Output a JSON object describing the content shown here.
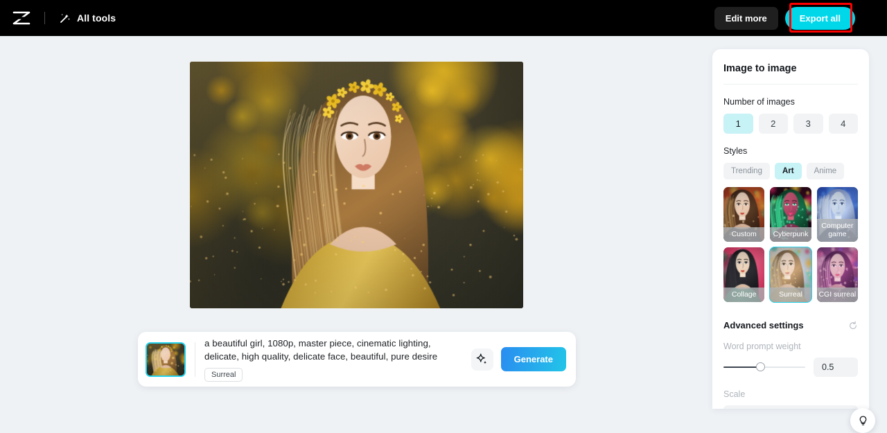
{
  "topbar": {
    "logo_icon": "capcut-logo-icon",
    "all_tools_icon": "magic-wand-icon",
    "all_tools_label": "All tools",
    "edit_more_label": "Edit more",
    "export_all_label": "Export all",
    "export_all_bg": "#00d8ea",
    "highlight_color": "#ff0000",
    "bar_bg": "#000000"
  },
  "canvas": {
    "background": "#eff2f5",
    "hero_alt": "generated-portrait-girl-with-yellow-flower-crown"
  },
  "prompt_bar": {
    "thumbnail_name": "source-image-thumbnail",
    "thumbnail_border": "#22d3ee",
    "text": "a beautiful girl, 1080p, master piece, cinematic lighting, delicate, high quality, delicate face, beautiful, pure desire",
    "text_line1": "a beautiful girl, 1080p, master piece, cinematic lighting,",
    "text_line2": "delicate, high quality, delicate face, beautiful, pure desire",
    "tag": "Surreal",
    "magic_icon": "sparkle-icon",
    "generate_label": "Generate",
    "generate_gradient_from": "#2a8df0",
    "generate_gradient_to": "#22c5e8"
  },
  "panel": {
    "title": "Image to image",
    "number_of_images": {
      "label": "Number of images",
      "options": [
        "1",
        "2",
        "3",
        "4"
      ],
      "selected": "1",
      "selected_bg": "#c7f2f6"
    },
    "styles": {
      "label": "Styles",
      "filters": [
        "Trending",
        "Art",
        "Anime"
      ],
      "filter_selected": "Art",
      "cards": [
        {
          "name": "Custom",
          "selected": false
        },
        {
          "name": "Cyberpunk",
          "selected": false
        },
        {
          "name": "Computer game",
          "selected": false
        },
        {
          "name": "Collage",
          "selected": false
        },
        {
          "name": "Surreal",
          "selected": true
        },
        {
          "name": "CGI surreal",
          "selected": false
        }
      ],
      "selection_color": "#22d3ee"
    },
    "advanced": {
      "title": "Advanced settings",
      "reset_icon": "reset-circular-arrow-icon",
      "word_prompt_weight_label": "Word prompt weight",
      "word_prompt_weight_value": "0.5",
      "slider_percent": 45,
      "scale_label": "Scale"
    }
  },
  "help": {
    "icon": "lightbulb-icon",
    "name": "help-tips-button"
  }
}
